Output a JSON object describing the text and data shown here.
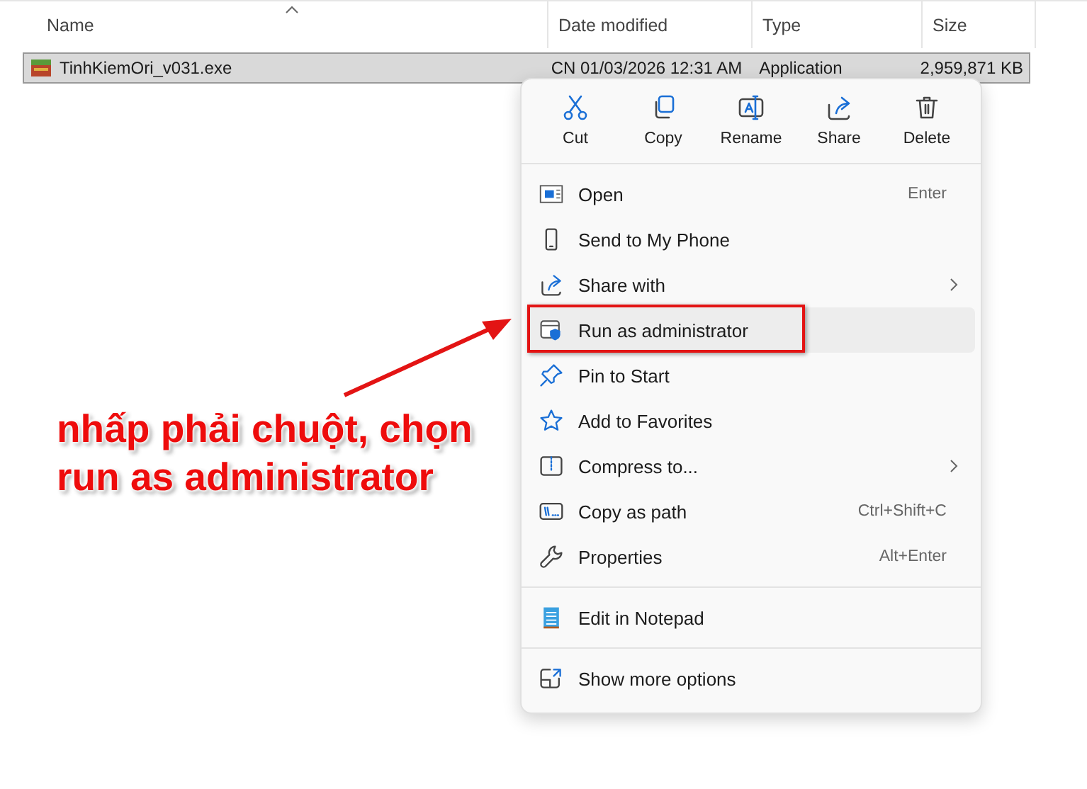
{
  "file_list": {
    "columns": [
      {
        "label": "Name",
        "sorted": true
      },
      {
        "label": "Date modified",
        "sorted": false
      },
      {
        "label": "Type",
        "sorted": false
      },
      {
        "label": "Size",
        "sorted": false
      }
    ],
    "rows": [
      {
        "name": "TinhKiemOri_v031.exe",
        "date": "CN 01/03/2026 12:31 AM",
        "type": "Application",
        "size": "2,959,871 KB",
        "selected": true
      }
    ]
  },
  "context_menu": {
    "quick_actions": [
      {
        "label": "Cut"
      },
      {
        "label": "Copy"
      },
      {
        "label": "Rename"
      },
      {
        "label": "Share"
      },
      {
        "label": "Delete"
      }
    ],
    "groups": [
      [
        {
          "label": "Open",
          "shortcut": "Enter",
          "submenu": false,
          "highlighted": false
        },
        {
          "label": "Send to My Phone",
          "submenu": false,
          "highlighted": false
        },
        {
          "label": "Share with",
          "submenu": true,
          "highlighted": false
        },
        {
          "label": "Run as administrator",
          "submenu": false,
          "highlighted": true,
          "annotated": true
        },
        {
          "label": "Pin to Start",
          "submenu": false,
          "highlighted": false
        },
        {
          "label": "Add to Favorites",
          "submenu": false,
          "highlighted": false
        },
        {
          "label": "Compress to...",
          "submenu": true,
          "highlighted": false
        },
        {
          "label": "Copy as path",
          "shortcut": "Ctrl+Shift+C",
          "submenu": false,
          "highlighted": false
        },
        {
          "label": "Properties",
          "shortcut": "Alt+Enter",
          "submenu": false,
          "highlighted": false
        }
      ],
      [
        {
          "label": "Edit in Notepad",
          "submenu": false,
          "highlighted": false
        }
      ],
      [
        {
          "label": "Show more options",
          "submenu": false,
          "highlighted": false
        }
      ]
    ]
  },
  "annotation": {
    "text": "nhấp phải chuột, chọn run as administrator"
  }
}
